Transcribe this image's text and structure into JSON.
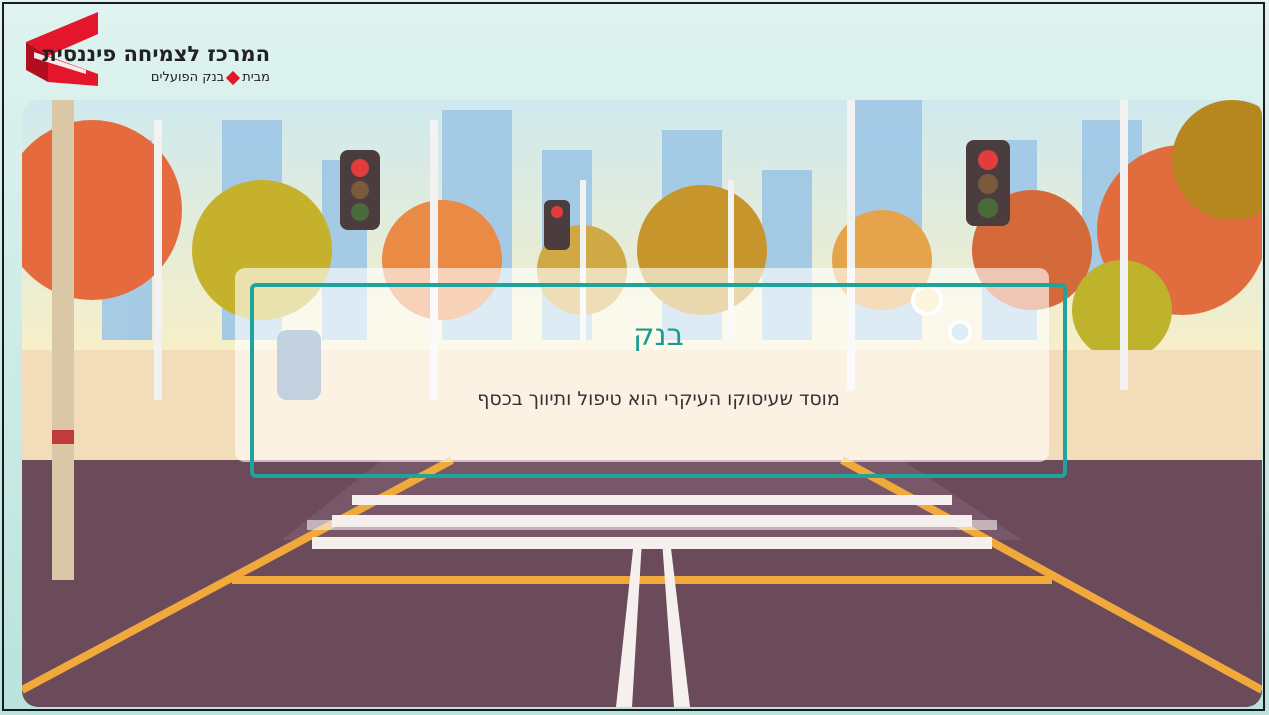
{
  "logo": {
    "title": "המרכז לצמיחה פיננסית",
    "subtitle_prefix": "מבית",
    "subtitle_bank": "בנק הפועלים"
  },
  "card": {
    "term": "בנק",
    "definition": "מוסד שעיסוקו העיקרי הוא טיפול ותיווך בכסף"
  },
  "colors": {
    "accent": "#1fa39a",
    "logo_red": "#e3162b",
    "road": "#6b4b5a",
    "sky": "#f7eec8"
  }
}
